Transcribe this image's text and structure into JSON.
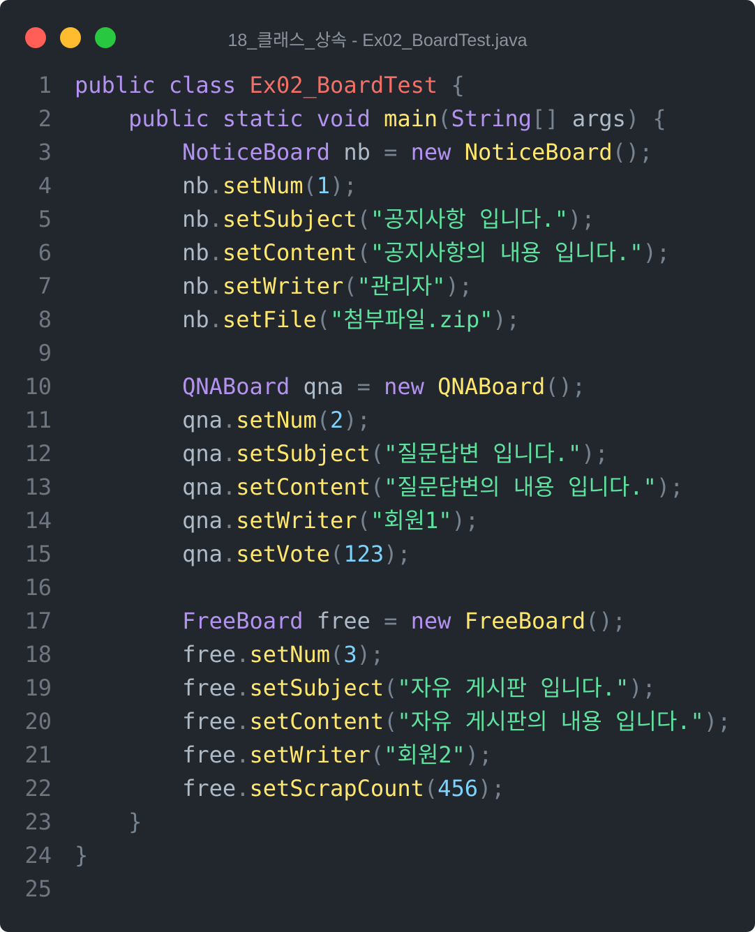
{
  "window": {
    "title": "18_클래스_상속 - Ex02_BoardTest.java",
    "controls": [
      {
        "name": "close",
        "color": "#ff5f57"
      },
      {
        "name": "minimize",
        "color": "#febc2e"
      },
      {
        "name": "zoom",
        "color": "#28c840"
      }
    ]
  },
  "code_lines": [
    [
      [
        "k",
        "public class "
      ],
      [
        "c",
        "Ex02_BoardTest"
      ],
      [
        "p",
        " {"
      ]
    ],
    [
      [
        "t",
        "    "
      ],
      [
        "k",
        "public static void "
      ],
      [
        "f",
        "main"
      ],
      [
        "p",
        "("
      ],
      [
        "k",
        "String"
      ],
      [
        "p",
        "[] "
      ],
      [
        "t",
        "args"
      ],
      [
        "p",
        ") {"
      ]
    ],
    [
      [
        "t",
        "        "
      ],
      [
        "k",
        "NoticeBoard "
      ],
      [
        "t",
        "nb "
      ],
      [
        "p",
        "= "
      ],
      [
        "k",
        "new "
      ],
      [
        "f",
        "NoticeBoard"
      ],
      [
        "p",
        "();"
      ]
    ],
    [
      [
        "t",
        "        nb"
      ],
      [
        "p",
        "."
      ],
      [
        "f",
        "setNum"
      ],
      [
        "p",
        "("
      ],
      [
        "n",
        "1"
      ],
      [
        "p",
        ");"
      ]
    ],
    [
      [
        "t",
        "        nb"
      ],
      [
        "p",
        "."
      ],
      [
        "f",
        "setSubject"
      ],
      [
        "p",
        "("
      ],
      [
        "s",
        "\"공지사항 입니다.\""
      ],
      [
        "p",
        ");"
      ]
    ],
    [
      [
        "t",
        "        nb"
      ],
      [
        "p",
        "."
      ],
      [
        "f",
        "setContent"
      ],
      [
        "p",
        "("
      ],
      [
        "s",
        "\"공지사항의 내용 입니다.\""
      ],
      [
        "p",
        ");"
      ]
    ],
    [
      [
        "t",
        "        nb"
      ],
      [
        "p",
        "."
      ],
      [
        "f",
        "setWriter"
      ],
      [
        "p",
        "("
      ],
      [
        "s",
        "\"관리자\""
      ],
      [
        "p",
        ");"
      ]
    ],
    [
      [
        "t",
        "        nb"
      ],
      [
        "p",
        "."
      ],
      [
        "f",
        "setFile"
      ],
      [
        "p",
        "("
      ],
      [
        "s",
        "\"첨부파일.zip\""
      ],
      [
        "p",
        ");"
      ]
    ],
    [],
    [
      [
        "t",
        "        "
      ],
      [
        "k",
        "QNABoard "
      ],
      [
        "t",
        "qna "
      ],
      [
        "p",
        "= "
      ],
      [
        "k",
        "new "
      ],
      [
        "f",
        "QNABoard"
      ],
      [
        "p",
        "();"
      ]
    ],
    [
      [
        "t",
        "        qna"
      ],
      [
        "p",
        "."
      ],
      [
        "f",
        "setNum"
      ],
      [
        "p",
        "("
      ],
      [
        "n",
        "2"
      ],
      [
        "p",
        ");"
      ]
    ],
    [
      [
        "t",
        "        qna"
      ],
      [
        "p",
        "."
      ],
      [
        "f",
        "setSubject"
      ],
      [
        "p",
        "("
      ],
      [
        "s",
        "\"질문답변 입니다.\""
      ],
      [
        "p",
        ");"
      ]
    ],
    [
      [
        "t",
        "        qna"
      ],
      [
        "p",
        "."
      ],
      [
        "f",
        "setContent"
      ],
      [
        "p",
        "("
      ],
      [
        "s",
        "\"질문답변의 내용 입니다.\""
      ],
      [
        "p",
        ");"
      ]
    ],
    [
      [
        "t",
        "        qna"
      ],
      [
        "p",
        "."
      ],
      [
        "f",
        "setWriter"
      ],
      [
        "p",
        "("
      ],
      [
        "s",
        "\"회원1\""
      ],
      [
        "p",
        ");"
      ]
    ],
    [
      [
        "t",
        "        qna"
      ],
      [
        "p",
        "."
      ],
      [
        "f",
        "setVote"
      ],
      [
        "p",
        "("
      ],
      [
        "n",
        "123"
      ],
      [
        "p",
        ");"
      ]
    ],
    [],
    [
      [
        "t",
        "        "
      ],
      [
        "k",
        "FreeBoard "
      ],
      [
        "t",
        "free "
      ],
      [
        "p",
        "= "
      ],
      [
        "k",
        "new "
      ],
      [
        "f",
        "FreeBoard"
      ],
      [
        "p",
        "();"
      ]
    ],
    [
      [
        "t",
        "        free"
      ],
      [
        "p",
        "."
      ],
      [
        "f",
        "setNum"
      ],
      [
        "p",
        "("
      ],
      [
        "n",
        "3"
      ],
      [
        "p",
        ");"
      ]
    ],
    [
      [
        "t",
        "        free"
      ],
      [
        "p",
        "."
      ],
      [
        "f",
        "setSubject"
      ],
      [
        "p",
        "("
      ],
      [
        "s",
        "\"자유 게시판 입니다.\""
      ],
      [
        "p",
        ");"
      ]
    ],
    [
      [
        "t",
        "        free"
      ],
      [
        "p",
        "."
      ],
      [
        "f",
        "setContent"
      ],
      [
        "p",
        "("
      ],
      [
        "s",
        "\"자유 게시판의 내용 입니다.\""
      ],
      [
        "p",
        ");"
      ]
    ],
    [
      [
        "t",
        "        free"
      ],
      [
        "p",
        "."
      ],
      [
        "f",
        "setWriter"
      ],
      [
        "p",
        "("
      ],
      [
        "s",
        "\"회원2\""
      ],
      [
        "p",
        ");"
      ]
    ],
    [
      [
        "t",
        "        free"
      ],
      [
        "p",
        "."
      ],
      [
        "f",
        "setScrapCount"
      ],
      [
        "p",
        "("
      ],
      [
        "n",
        "456"
      ],
      [
        "p",
        ");"
      ]
    ],
    [
      [
        "p",
        "    }"
      ]
    ],
    [
      [
        "p",
        "}"
      ]
    ],
    []
  ]
}
